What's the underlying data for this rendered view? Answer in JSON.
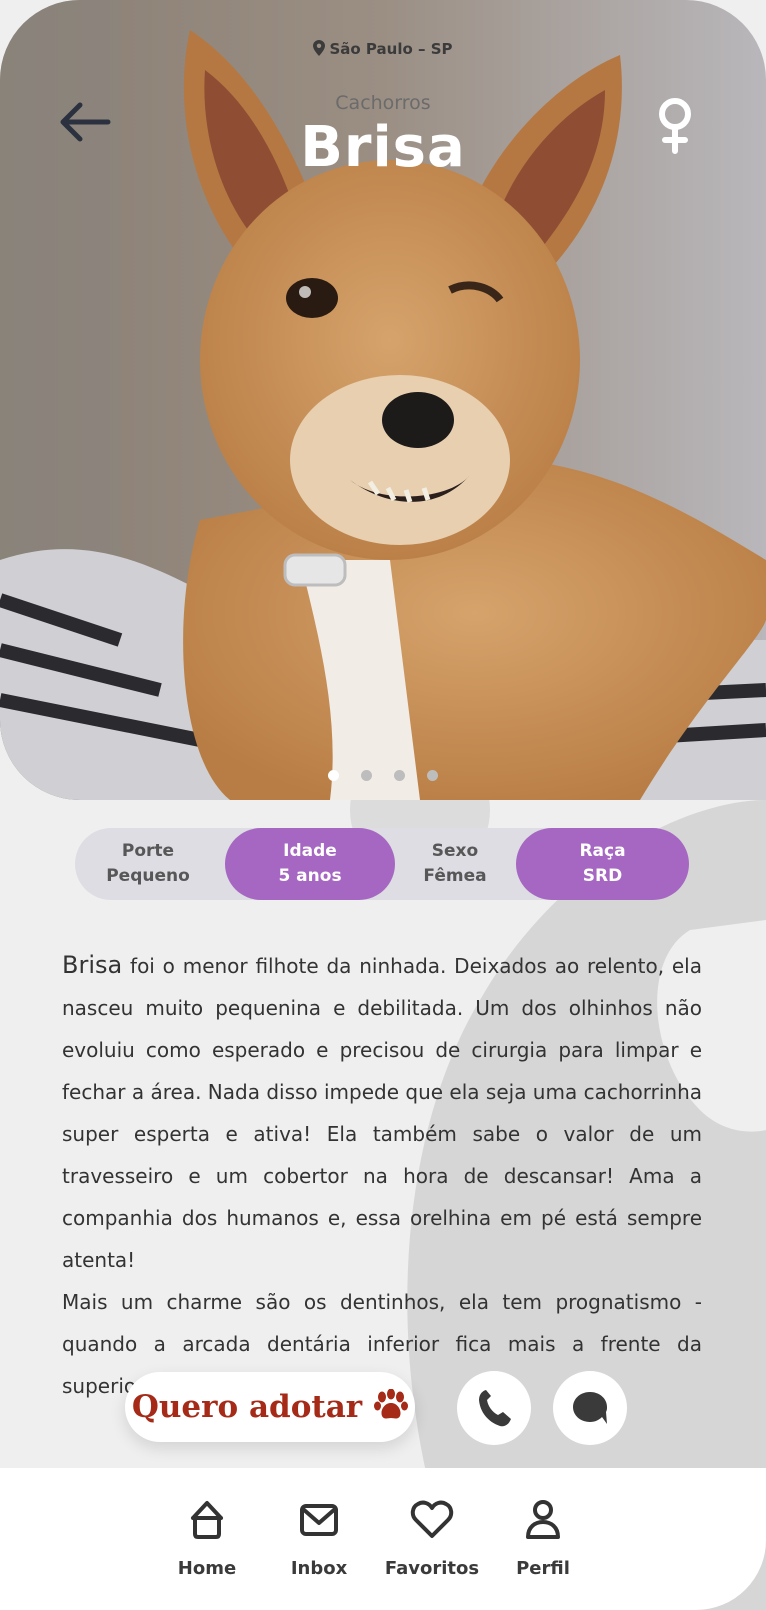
{
  "header": {
    "location": "São Paulo – SP",
    "category": "Cachorros",
    "name": "Brisa",
    "sex_symbol": "female-icon"
  },
  "carousel": {
    "total": 4,
    "active": 1
  },
  "info": [
    {
      "title": "Porte",
      "value": "Pequeno",
      "highlighted": false
    },
    {
      "title": "Idade",
      "value": "5 anos",
      "highlighted": true
    },
    {
      "title": "Sexo",
      "value": "Fêmea",
      "highlighted": false
    },
    {
      "title": "Raça",
      "value": "SRD",
      "highlighted": true
    }
  ],
  "description": {
    "lead": "Brisa",
    "p1": " foi o menor filhote da ninhada. Deixados ao relento, ela nasceu muito pequenina e debilitada. Um dos olhinhos não evoluiu como esperado e precisou de cirurgia para limpar e fechar a área. Nada disso impede que ela seja uma cachorrinha super esperta e ativa! Ela também sabe o valor de um travesseiro e um cobertor na hora de descansar! Ama a companhia dos humanos e, essa orelhina em pé está sempre atenta!",
    "p2": "Mais um charme são os dentinhos, ela tem prognatismo - quando a arcada dentária inferior fica mais a frente da superior."
  },
  "actions": {
    "adopt_label": "Quero adotar",
    "call_icon": "phone-icon",
    "chat_icon": "chat-icon"
  },
  "nav": [
    {
      "label": "Home",
      "icon": "home-icon"
    },
    {
      "label": "Inbox",
      "icon": "mail-icon"
    },
    {
      "label": "Favoritos",
      "icon": "heart-icon"
    },
    {
      "label": "Perfil",
      "icon": "user-icon"
    }
  ],
  "colors": {
    "accent": "#a667c2",
    "adopt": "#a52a18",
    "background": "#efefef",
    "pill_bar": "#dddde3"
  }
}
